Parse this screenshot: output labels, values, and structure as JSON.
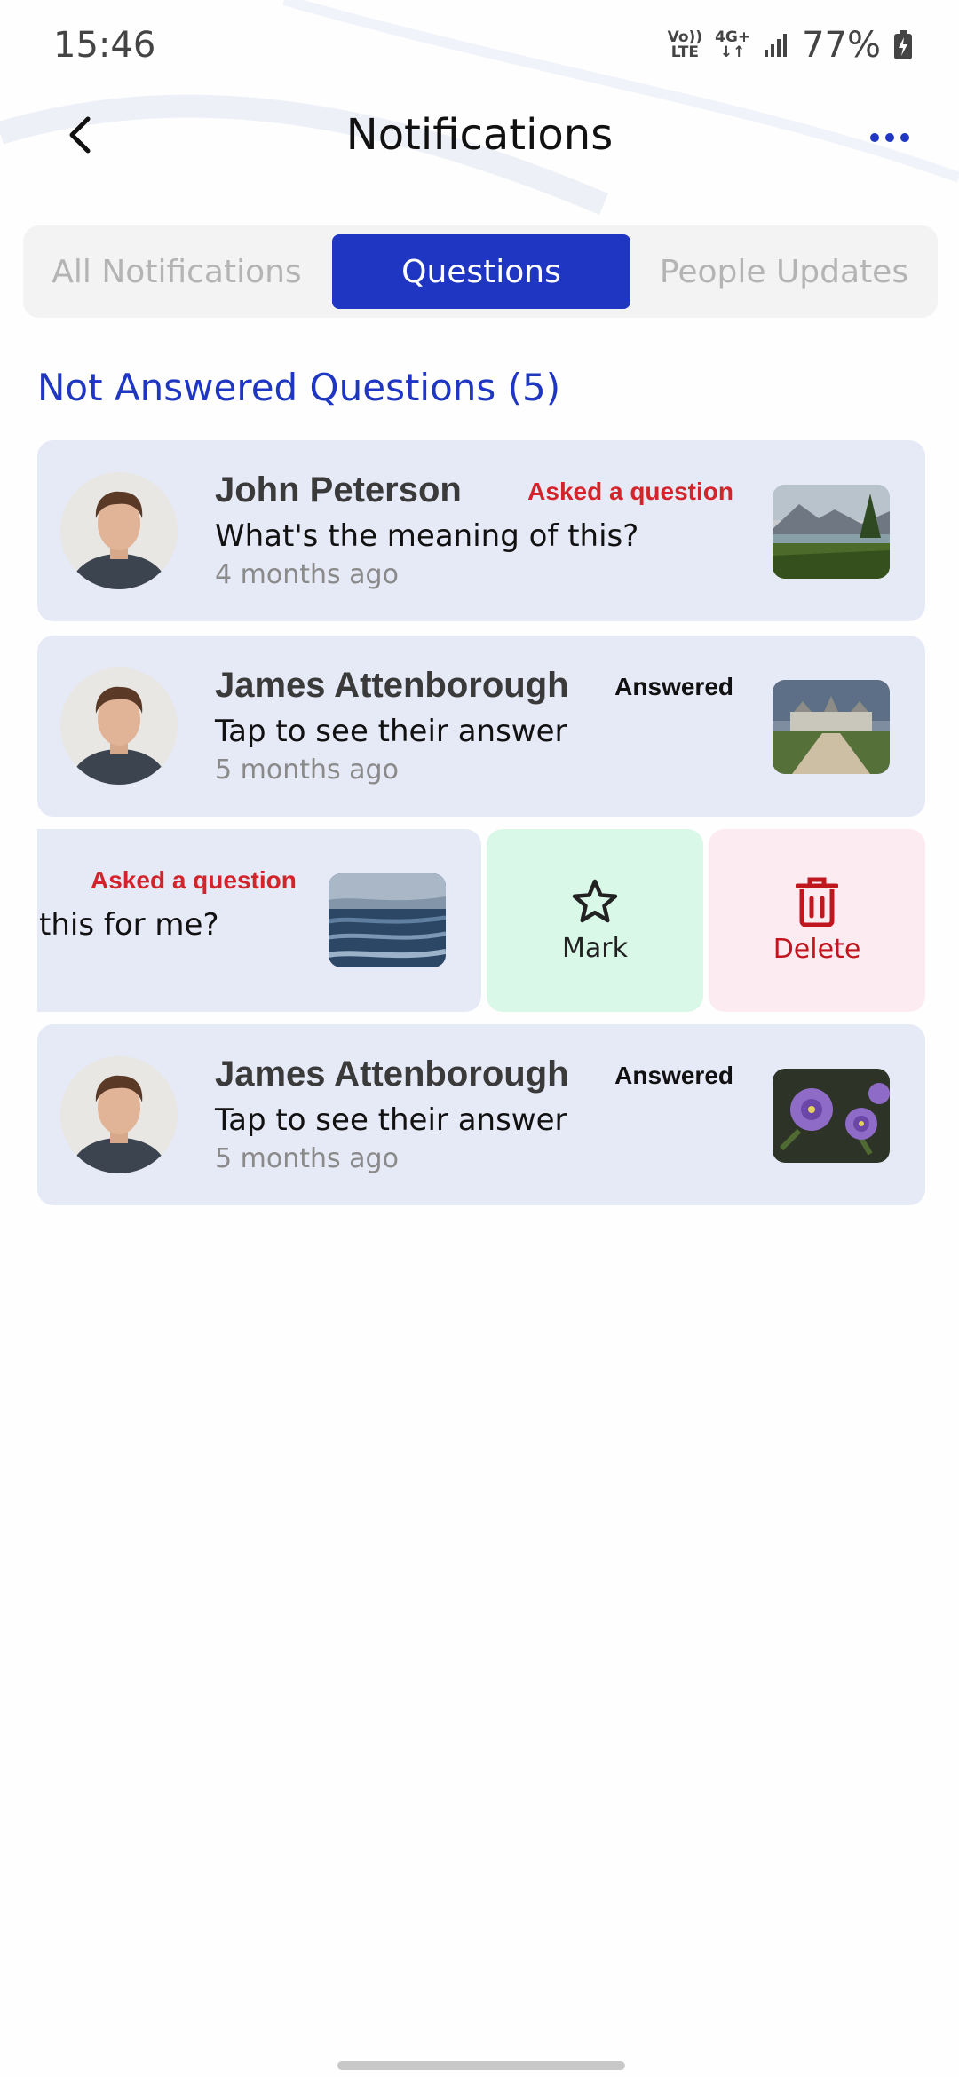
{
  "status_bar": {
    "time": "15:46",
    "volte_line1": "Vo))",
    "volte_line2": "LTE",
    "network_line1": "4G+",
    "network_line2": "↓↑",
    "battery": "77%"
  },
  "header": {
    "title": "Notifications"
  },
  "tabs": [
    {
      "label": "All Notifications",
      "active": false
    },
    {
      "label": "Questions",
      "active": true
    },
    {
      "label": "People Updates",
      "active": false
    }
  ],
  "section_title": "Not Answered Questions (5)",
  "cards": [
    {
      "name": "John Peterson",
      "status": "Asked a question",
      "message": "What's the meaning of this?",
      "time": "4 months ago",
      "thumbnail": "lake-landscape"
    },
    {
      "name": "James Attenborough",
      "status": "Answered",
      "message": "Tap to see their answer",
      "time": "5 months ago",
      "thumbnail": "castle-landscape"
    },
    {
      "name": "James Attenborough",
      "status": "Answered",
      "message": "Tap to see their answer",
      "time": "5 months ago",
      "thumbnail": "purple-flowers"
    }
  ],
  "swiped_card": {
    "status": "Asked a question",
    "message": "this for me?",
    "thumbnail": "sea-waves"
  },
  "swipe_actions": {
    "mark_label": "Mark",
    "delete_label": "Delete"
  },
  "colors": {
    "accent": "#1e36c2",
    "card_bg": "#e6e9f6",
    "asked": "#d2242a",
    "mark_bg": "#d9f8e8",
    "delete_bg": "#fdebf2",
    "delete": "#c0171e"
  }
}
